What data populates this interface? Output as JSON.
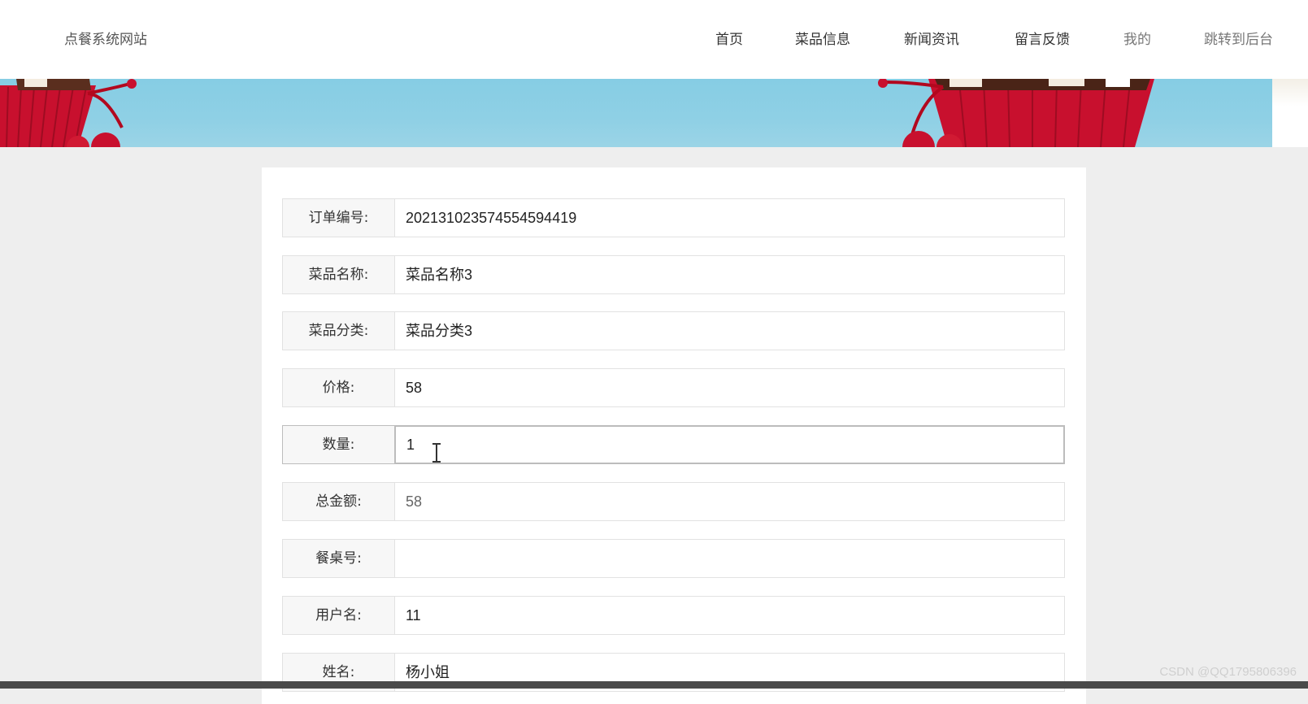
{
  "header": {
    "site_title": "点餐系统网站",
    "nav": [
      "首页",
      "菜品信息",
      "新闻资讯",
      "留言反馈",
      "我的",
      "跳转到后台"
    ]
  },
  "form": {
    "fields": [
      {
        "label": "订单编号:",
        "value": "20213102357455459441 9"
      },
      {
        "label": "菜品名称:",
        "value": "菜品名称3"
      },
      {
        "label": "菜品分类:",
        "value": "菜品分类3"
      },
      {
        "label": "价格:",
        "value": "58"
      },
      {
        "label": "数量:",
        "value": "1"
      },
      {
        "label": "总金额:",
        "value": "58"
      },
      {
        "label": "餐桌号:",
        "value": ""
      },
      {
        "label": "用户名:",
        "value": "11"
      },
      {
        "label": "姓名:",
        "value": "杨小姐"
      }
    ]
  },
  "watermark": "CSDN @QQ1795806396",
  "colors": {
    "banner_sky": "#86cde4",
    "cupcake_red": "#c8102e"
  }
}
